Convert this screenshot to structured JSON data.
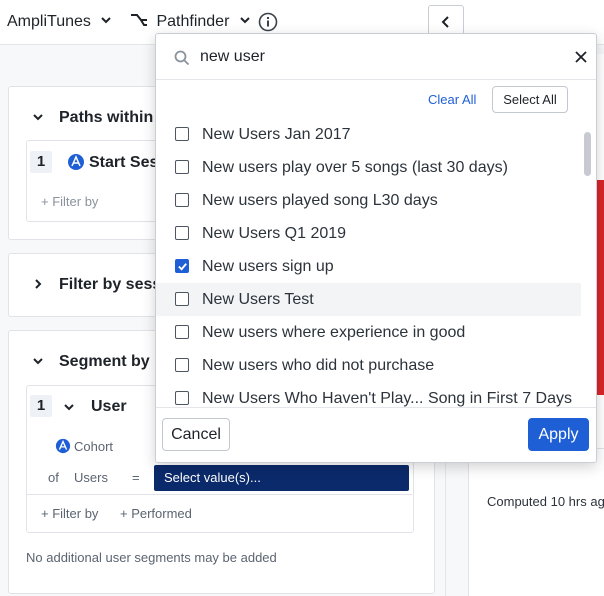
{
  "topbar": {
    "app_name": "AmpliTunes",
    "chart_type": "Pathfinder"
  },
  "left": {
    "paths_title": "Paths within",
    "start_row_num": "1",
    "start_label": "Start Ses",
    "filter_by": "+ Filter by",
    "filter_session_title": "Filter by sess",
    "segment_title": "Segment by",
    "segment_num": "1",
    "segment_user": "User",
    "cohort_label": "Cohort",
    "of_label": "of",
    "users_label": "Users",
    "equals": "=",
    "select_values": "Select value(s)...",
    "filter_by2": "+ Filter by",
    "performed": "+ Performed",
    "no_more_segments": "No additional user segments may be added"
  },
  "right": {
    "computed": "Computed 10 hrs ag"
  },
  "dropdown": {
    "search_value": "new user",
    "clear_all": "Clear All",
    "select_all": "Select All",
    "items": [
      {
        "label": "New Users Jan 2017",
        "checked": false
      },
      {
        "label": "New users play over 5 songs (last 30 days)",
        "checked": false
      },
      {
        "label": "New users played song L30 days",
        "checked": false
      },
      {
        "label": "New Users Q1 2019",
        "checked": false
      },
      {
        "label": "New users sign up",
        "checked": true
      },
      {
        "label": "New Users Test",
        "checked": false
      },
      {
        "label": "New users where experience in good",
        "checked": false
      },
      {
        "label": "New users who did not purchase",
        "checked": false
      },
      {
        "label": "New Users Who Haven't Play...   Song in First 7 Days",
        "checked": false
      }
    ],
    "cancel": "Cancel",
    "apply": "Apply"
  },
  "colors": {
    "primary": "#1f5fd6",
    "dark_select": "#0b2a6b",
    "red_accent": "#d7262a"
  }
}
